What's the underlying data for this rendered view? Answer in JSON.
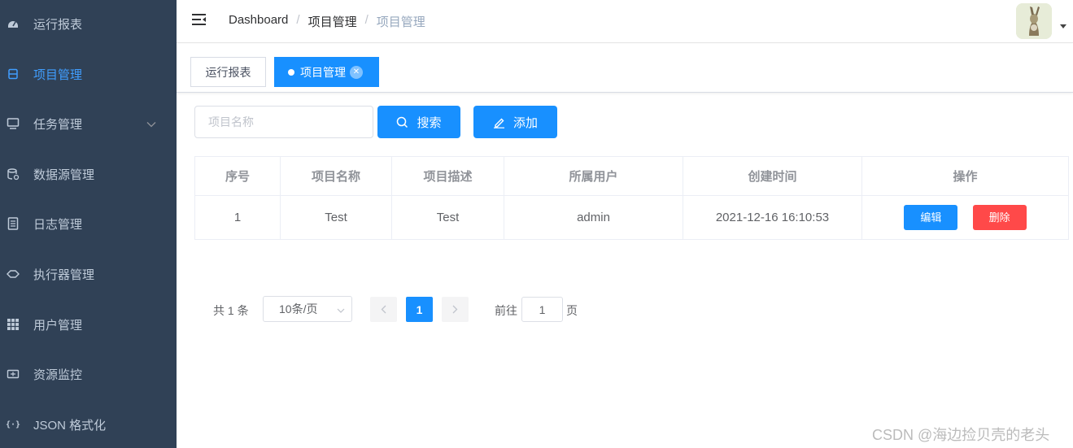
{
  "sidebar": {
    "items": [
      {
        "label": "运行报表",
        "icon": "dashboard-icon"
      },
      {
        "label": "项目管理",
        "icon": "project-icon"
      },
      {
        "label": "任务管理",
        "icon": "monitor-icon"
      },
      {
        "label": "数据源管理",
        "icon": "database-icon"
      },
      {
        "label": "日志管理",
        "icon": "document-icon"
      },
      {
        "label": "执行器管理",
        "icon": "executor-icon"
      },
      {
        "label": "用户管理",
        "icon": "table-icon"
      },
      {
        "label": "资源监控",
        "icon": "monitor-resource-icon"
      },
      {
        "label": "JSON 格式化",
        "icon": "json-icon"
      }
    ],
    "active_index": 1
  },
  "header": {
    "breadcrumb": [
      "Dashboard",
      "项目管理",
      "项目管理"
    ]
  },
  "tags": [
    {
      "label": "运行报表",
      "active": false
    },
    {
      "label": "项目管理",
      "active": true
    }
  ],
  "toolbar": {
    "search_placeholder": "项目名称",
    "search_label": "搜索",
    "add_label": "添加"
  },
  "table": {
    "columns": [
      "序号",
      "项目名称",
      "项目描述",
      "所属用户",
      "创建时间",
      "操作"
    ],
    "rows": [
      {
        "index": "1",
        "name": "Test",
        "desc": "Test",
        "user": "admin",
        "created": "2021-12-16 16:10:53"
      }
    ],
    "edit_label": "编辑",
    "delete_label": "删除"
  },
  "pagination": {
    "total": "共 1 条",
    "page_size": "10条/页",
    "current_page": "1",
    "goto_prefix": "前往",
    "goto_value": "1",
    "goto_suffix": "页"
  },
  "watermark": "CSDN @海边捡贝壳的老头",
  "colors": {
    "sidebar_bg": "#304156",
    "accent": "#1890ff",
    "danger": "#ff4949"
  }
}
